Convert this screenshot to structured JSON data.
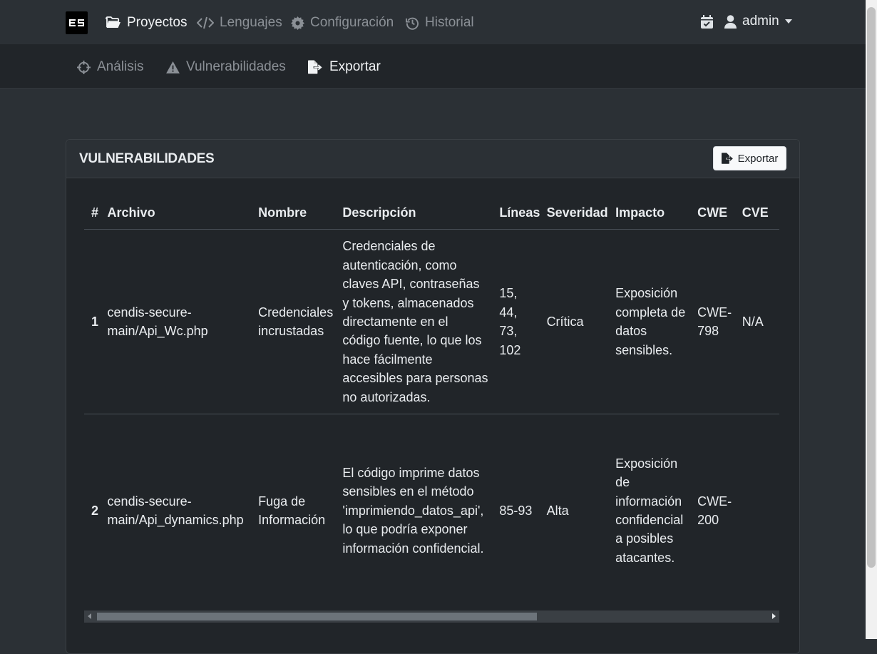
{
  "topnav": {
    "brand_text": "ES",
    "items": [
      {
        "label": "Proyectos",
        "icon": "folder-open-icon"
      },
      {
        "label": "Lenguajes",
        "icon": "code-icon"
      },
      {
        "label": "Configuración",
        "icon": "gear-icon"
      },
      {
        "label": "Historial",
        "icon": "history-icon"
      }
    ],
    "user": {
      "name": "admin",
      "icon": "user-icon",
      "calendar_icon": "calendar-check-icon"
    }
  },
  "subnav": {
    "items": [
      {
        "label": "Análisis",
        "icon": "crosshairs-icon"
      },
      {
        "label": "Vulnerabilidades",
        "icon": "warning-icon"
      },
      {
        "label": "Exportar",
        "icon": "file-export-icon"
      }
    ]
  },
  "card": {
    "title": "VULNERABILIDADES",
    "export_label": "Exportar"
  },
  "table": {
    "headers": [
      "#",
      "Archivo",
      "Nombre",
      "Descripción",
      "Líneas",
      "Severidad",
      "Impacto",
      "CWE",
      "CVE"
    ],
    "rows": [
      {
        "num": "1",
        "archivo": "cendis-secure-main/Api_Wc.php",
        "nombre": "Credenciales incrustadas",
        "descripcion": "Credenciales de autenticación, como claves API, contraseñas y tokens, almacenados directamente en el código fuente, lo que los hace fácilmente accesibles para personas no autorizadas.",
        "lineas": "15, 44, 73, 102",
        "severidad": "Crítica",
        "impacto": "Exposición completa de datos sensibles.",
        "cwe": "CWE-798",
        "cve": "N/A"
      },
      {
        "num": "2",
        "archivo": "cendis-secure-main/Api_dynamics.php",
        "nombre": "Fuga de Información",
        "descripcion": "El código imprime datos sensibles en el método 'imprimiendo_datos_api', lo que podría exponer información confidencial.",
        "lineas": "85-93",
        "severidad": "Alta",
        "impacto": "Exposición de información confidencial a posibles atacantes.",
        "cwe": "CWE-200",
        "cve": ""
      }
    ]
  }
}
